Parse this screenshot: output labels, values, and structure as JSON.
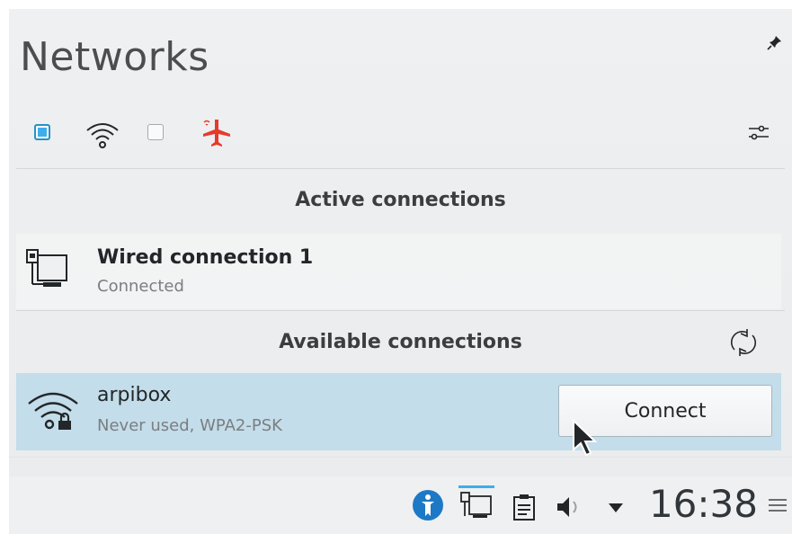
{
  "popup": {
    "title": "Networks",
    "toolbar": {
      "wired_toggle": "checked",
      "wifi_toggle": "unchecked",
      "airplane_mode": "on"
    },
    "active_connections": {
      "header": "Active connections",
      "items": [
        {
          "name": "Wired connection 1",
          "status": "Connected",
          "icon": "wired-network-icon"
        }
      ]
    },
    "available_connections": {
      "header": "Available connections",
      "items": [
        {
          "name": "arpibox",
          "status": "Never used, WPA2-PSK",
          "icon": "wifi-locked-icon",
          "button": "Connect"
        }
      ]
    }
  },
  "taskbar": {
    "clock": "16:38",
    "tray_icons": [
      "info-icon",
      "network-icon",
      "clipboard-icon",
      "volume-icon",
      "expand-arrow-icon"
    ]
  },
  "colors": {
    "accent": "#3daee9",
    "selection": "#c3ddea",
    "airplane": "#e8392b",
    "info_blue": "#1d79c6"
  }
}
